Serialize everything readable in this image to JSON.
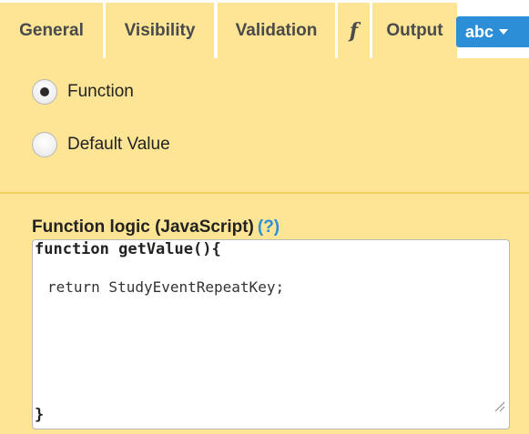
{
  "tabs": [
    {
      "label": "General"
    },
    {
      "label": "Visibility"
    },
    {
      "label": "Validation"
    },
    {
      "label": "f"
    },
    {
      "label": "Output"
    }
  ],
  "type_dropdown": {
    "label": "abc"
  },
  "mode_options": [
    {
      "label": "Function",
      "selected": true
    },
    {
      "label": "Default Value",
      "selected": false
    }
  ],
  "function_logic": {
    "label": "Function logic (JavaScript)",
    "help": "(?)",
    "code_lines": [
      "function getValue(){",
      "return StudyEventRepeatKey;",
      "}"
    ]
  },
  "colors": {
    "panel_bg": "#fde595",
    "accent": "#2d8ed8",
    "link": "#2b8fd6"
  }
}
